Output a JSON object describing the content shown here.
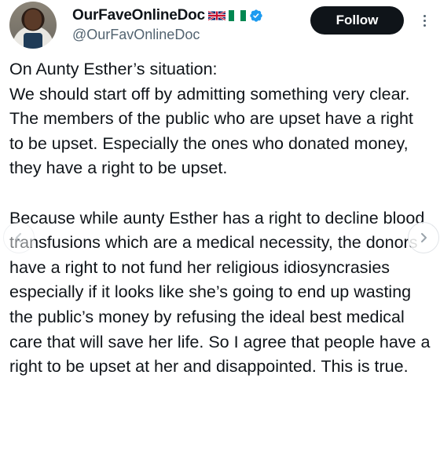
{
  "author": {
    "display_name": "OurFaveOnlineDoc",
    "handle": "@OurFavOnlineDoc",
    "flags": [
      "uk-flag",
      "nigeria-flag"
    ],
    "verified_color": "#1d9bf0"
  },
  "actions": {
    "follow_label": "Follow",
    "more_icon": "more-dots-icon"
  },
  "post": {
    "paragraph_1": "On Aunty Esther’s situation:\nWe should start off by admitting something very clear. The members of the public who are upset have a right to be upset. Especially the ones who donated money, they have a right to be upset.",
    "paragraph_2": "Because while aunty Esther has a right to decline blood transfusions which are a medical necessity, the donors have a right to not fund her religious idiosyncrasies especially if it looks like she’s going to end up wasting the public’s money by refusing the ideal best medical care that will save her life. So I agree that people have a right to be upset at her and disappointed. This is true."
  },
  "carousel": {
    "prev_icon": "chevron-left-icon",
    "next_icon": "chevron-right-icon"
  }
}
